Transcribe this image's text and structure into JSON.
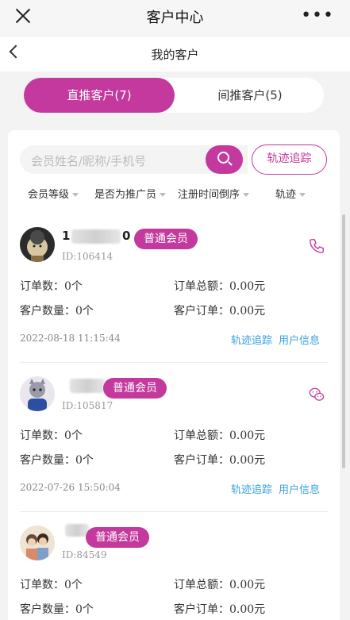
{
  "header": {
    "title": "客户中心",
    "more": "•••"
  },
  "nav": {
    "title": "我的客户"
  },
  "tabs": [
    {
      "label": "直推客户(7)",
      "active": true
    },
    {
      "label": "间推客户(5)",
      "active": false
    }
  ],
  "search": {
    "placeholder": "会员姓名/昵称/手机号",
    "track_label": "轨迹追踪"
  },
  "filters": [
    "会员等级",
    "是否为推广员",
    "注册时间倒序",
    "轨迹"
  ],
  "colors": {
    "accent": "#c3399d",
    "link": "#3aa0e0"
  },
  "customers": [
    {
      "name_prefix": "1",
      "name_suffix": "0",
      "level": "普通会员",
      "id": "ID:106414",
      "orders_label": "订单数：",
      "orders": "0个",
      "total_label": "订单总额：",
      "total": "0.00元",
      "clients_label": "客户数量：",
      "clients": "0个",
      "client_orders_label": "客户订单：",
      "client_orders": "0.00元",
      "date": "2022-08-18 11:15:44",
      "contact_icon": "phone-icon"
    },
    {
      "name_prefix": "",
      "name_suffix": "",
      "level": "普通会员",
      "id": "ID:105817",
      "orders_label": "订单数：",
      "orders": "0个",
      "total_label": "订单总额：",
      "total": "0.00元",
      "clients_label": "客户数量：",
      "clients": "0个",
      "client_orders_label": "客户订单：",
      "client_orders": "0.00元",
      "date": "2022-07-26 15:50:04",
      "contact_icon": "wechat-icon"
    },
    {
      "name_prefix": "",
      "name_suffix": "",
      "level": "普通会员",
      "id": "ID:84549",
      "orders_label": "订单数：",
      "orders": "0个",
      "total_label": "订单总额：",
      "total": "0.00元",
      "clients_label": "客户数量：",
      "clients": "0个",
      "client_orders_label": "客户订单：",
      "client_orders": "0.00元"
    }
  ],
  "actions": {
    "track": "轨迹追踪",
    "user_info": "用户信息"
  }
}
